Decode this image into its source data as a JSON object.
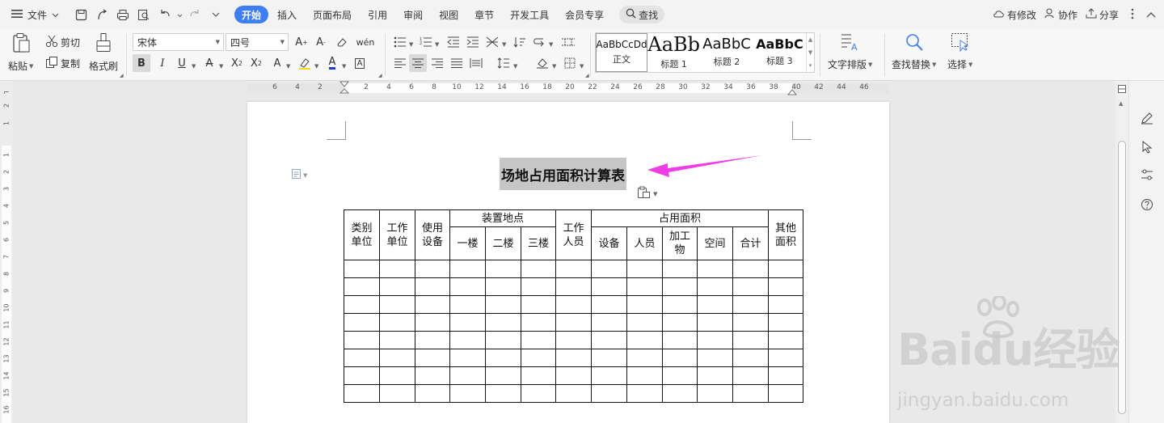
{
  "menu": {
    "file_label": "文件",
    "tabs": [
      {
        "label": "开始",
        "active": true
      },
      {
        "label": "插入"
      },
      {
        "label": "页面布局"
      },
      {
        "label": "引用"
      },
      {
        "label": "审阅"
      },
      {
        "label": "视图"
      },
      {
        "label": "章节"
      },
      {
        "label": "开发工具"
      },
      {
        "label": "会员专享"
      }
    ],
    "search_label": "查找",
    "right": {
      "modified": "有修改",
      "collaborate": "协作",
      "share": "分享"
    }
  },
  "ribbon": {
    "paste": "粘贴",
    "cut": "剪切",
    "copy": "复制",
    "format_painter": "格式刷",
    "font_name": "宋体",
    "font_size": "四号",
    "bold": "B",
    "italic": "I",
    "underline": "U",
    "styles": [
      {
        "preview": "AaBbCcDd",
        "name": "正文"
      },
      {
        "preview": "AaBb",
        "name": "标题 1"
      },
      {
        "preview": "AaBbC",
        "name": "标题 2"
      },
      {
        "preview": "AaBbC",
        "name": "标题 3"
      }
    ],
    "text_layout": "文字排版",
    "find_replace": "查找替换",
    "select": "选择"
  },
  "ruler": {
    "h": [
      "6",
      "4",
      "2",
      "2",
      "4",
      "6",
      "8",
      "10",
      "12",
      "14",
      "16",
      "18",
      "20",
      "22",
      "24",
      "26",
      "28",
      "30",
      "32",
      "34",
      "36",
      "38",
      "40",
      "42",
      "44",
      "46"
    ],
    "v": [
      "2",
      "1",
      "1",
      "2",
      "3",
      "4",
      "5",
      "6",
      "7",
      "8",
      "9",
      "10",
      "11",
      "12",
      "13",
      "14",
      "15",
      "16"
    ]
  },
  "document": {
    "title": "场地占用面积计算表",
    "table": {
      "h_type_unit": "类别单位",
      "h_work_unit": "工作单位",
      "h_equipment_use": "使用设备",
      "h_install_location": "装置地点",
      "h_floor1": "一楼",
      "h_floor2": "二楼",
      "h_floor3": "三楼",
      "h_staff": "工作人员",
      "h_occupied_area": "占用面积",
      "h_equipment": "设备",
      "h_personnel": "人员",
      "h_processed": "加工物",
      "h_space": "空间",
      "h_total": "合计",
      "h_other_area": "其他面积",
      "empty_rows": 8
    }
  },
  "watermark": {
    "brand": "Baidu经验",
    "url": "jingyan.baidu.com"
  },
  "colors": {
    "accent": "#3d7df5",
    "arrow": "#f03ce6"
  }
}
